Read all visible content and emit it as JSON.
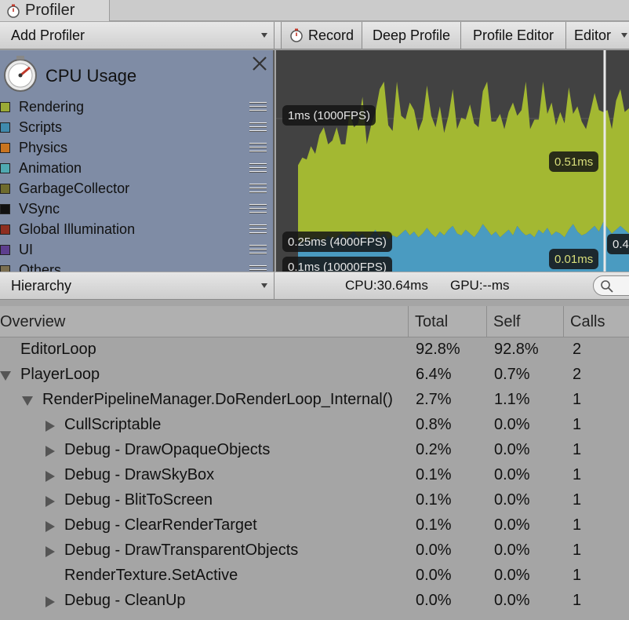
{
  "window": {
    "title": "Profiler",
    "icon": "stopwatch-icon"
  },
  "toolbar": {
    "add_profiler": "Add Profiler",
    "record": "Record",
    "deep_profile": "Deep Profile",
    "profile_editor": "Profile Editor",
    "editor": "Editor"
  },
  "legend": {
    "title": "CPU Usage",
    "items": [
      {
        "label": "Rendering",
        "color": "#9aaa35"
      },
      {
        "label": "Scripts",
        "color": "#3f8aad"
      },
      {
        "label": "Physics",
        "color": "#c9741f"
      },
      {
        "label": "Animation",
        "color": "#4fa9b1"
      },
      {
        "label": "GarbageCollector",
        "color": "#6e6b2d"
      },
      {
        "label": "VSync",
        "color": "#111111"
      },
      {
        "label": "Global Illumination",
        "color": "#8e2e20"
      },
      {
        "label": "UI",
        "color": "#5d3e8e"
      },
      {
        "label": "Others",
        "color": "#7a6e50"
      }
    ]
  },
  "chart_data": {
    "type": "area",
    "title": "",
    "xlabel": "",
    "ylabel": "",
    "annotations": [
      "1ms (1000FPS)",
      "0.51ms",
      "0.25ms (4000FPS)",
      "0.01ms",
      "0.1ms (10000FPS)",
      "0.4"
    ],
    "series": [
      {
        "name": "Scripts",
        "color": "#4a9bc1",
        "values": [
          0.16,
          0.15,
          0.17,
          0.16,
          0.18,
          0.17,
          0.16,
          0.19,
          0.17,
          0.18,
          0.2,
          0.17,
          0.19,
          0.21,
          0.18,
          0.2,
          0.17,
          0.19,
          0.22,
          0.18,
          0.2,
          0.17,
          0.19,
          0.18,
          0.2,
          0.22,
          0.19,
          0.21,
          0.18,
          0.2,
          0.23,
          0.2,
          0.18,
          0.21,
          0.19,
          0.22,
          0.24,
          0.2,
          0.19,
          0.22,
          0.2,
          0.18,
          0.21,
          0.25,
          0.22,
          0.19,
          0.21,
          0.18,
          0.2,
          0.22,
          0.19,
          0.24,
          0.21,
          0.19,
          0.2,
          0.18,
          0.22,
          0.2,
          0.23,
          0.19,
          0.21,
          0.2,
          0.18,
          0.22,
          0.25,
          0.21,
          0.19,
          0.2,
          0.22,
          0.24,
          0.21,
          0.26,
          0.23,
          0.2,
          0.22,
          0.24,
          0.22,
          0.2
        ]
      },
      {
        "name": "Rendering",
        "color": "#a3b832",
        "values": [
          0.4,
          0.45,
          0.42,
          0.5,
          0.44,
          0.55,
          0.6,
          0.48,
          0.52,
          0.58,
          0.47,
          0.5,
          0.65,
          0.55,
          0.6,
          0.72,
          0.5,
          0.58,
          0.62,
          0.78,
          0.95,
          0.6,
          0.55,
          0.85,
          0.62,
          0.58,
          0.7,
          0.64,
          0.56,
          0.6,
          0.75,
          0.62,
          0.58,
          0.66,
          0.54,
          0.6,
          0.72,
          0.55,
          0.62,
          0.58,
          0.68,
          0.6,
          0.55,
          0.7,
          0.82,
          0.6,
          0.58,
          0.65,
          0.55,
          0.62,
          0.7,
          0.58,
          0.64,
          0.9,
          0.55,
          0.62,
          0.58,
          0.95,
          0.6,
          0.7,
          0.56,
          0.64,
          0.6,
          0.75,
          0.58,
          0.66,
          0.6,
          0.55,
          0.62,
          0.7,
          0.64,
          0.58,
          0.62,
          0.55,
          0.68,
          0.72,
          0.62,
          0.66
        ]
      }
    ]
  },
  "subbar": {
    "view": "Hierarchy",
    "cpu": "CPU:30.64ms",
    "gpu": "GPU:--ms"
  },
  "table": {
    "columns": [
      "Overview",
      "Total",
      "Self",
      "Calls"
    ],
    "rows": [
      {
        "name": "EditorLoop",
        "total": "92.8%",
        "self": "92.8%",
        "calls": "2",
        "depth": 0,
        "arrow": "none"
      },
      {
        "name": "PlayerLoop",
        "total": "6.4%",
        "self": "0.7%",
        "calls": "2",
        "depth": 0,
        "arrow": "down"
      },
      {
        "name": "RenderPipelineManager.DoRenderLoop_Internal()",
        "total": "2.7%",
        "self": "1.1%",
        "calls": "1",
        "depth": 1,
        "arrow": "down"
      },
      {
        "name": "CullScriptable",
        "total": "0.8%",
        "self": "0.0%",
        "calls": "1",
        "depth": 2,
        "arrow": "right"
      },
      {
        "name": "Debug - DrawOpaqueObjects",
        "total": "0.2%",
        "self": "0.0%",
        "calls": "1",
        "depth": 2,
        "arrow": "right"
      },
      {
        "name": "Debug - DrawSkyBox",
        "total": "0.1%",
        "self": "0.0%",
        "calls": "1",
        "depth": 2,
        "arrow": "right"
      },
      {
        "name": "Debug - BlitToScreen",
        "total": "0.1%",
        "self": "0.0%",
        "calls": "1",
        "depth": 2,
        "arrow": "right"
      },
      {
        "name": "Debug - ClearRenderTarget",
        "total": "0.1%",
        "self": "0.0%",
        "calls": "1",
        "depth": 2,
        "arrow": "right"
      },
      {
        "name": "Debug - DrawTransparentObjects",
        "total": "0.0%",
        "self": "0.0%",
        "calls": "1",
        "depth": 2,
        "arrow": "right"
      },
      {
        "name": "RenderTexture.SetActive",
        "total": "0.0%",
        "self": "0.0%",
        "calls": "1",
        "depth": 2,
        "arrow": "none"
      },
      {
        "name": "Debug - CleanUp",
        "total": "0.0%",
        "self": "0.0%",
        "calls": "1",
        "depth": 2,
        "arrow": "right"
      }
    ]
  }
}
